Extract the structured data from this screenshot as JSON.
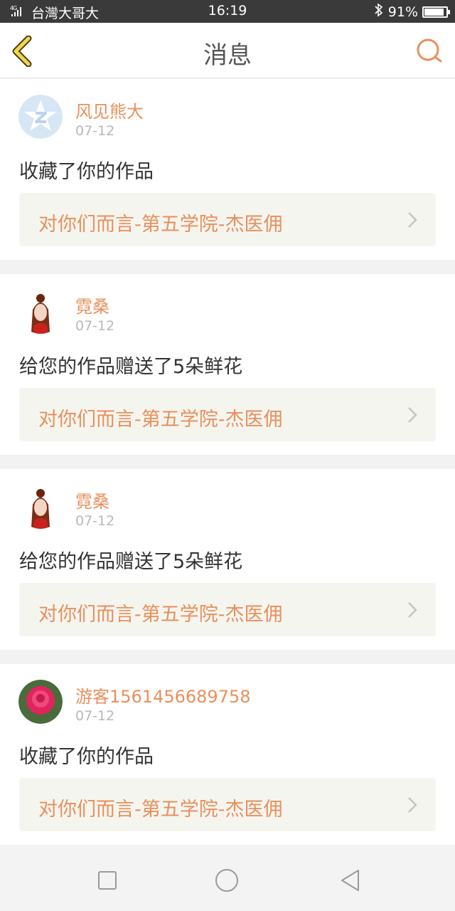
{
  "status_bar": {
    "carrier": "台灣大哥大",
    "network": "4G",
    "time": "16:19",
    "battery_percent": "91%",
    "battery_level": 0.91,
    "icons": [
      "signal-icon",
      "bluetooth-icon",
      "battery-icon"
    ]
  },
  "nav": {
    "title": "消息",
    "back_icon": "chevron-left-icon",
    "search_icon": "search-icon",
    "accent_color": "#e8905c",
    "back_color": "#f2c94c"
  },
  "messages": [
    {
      "username": "风见熊大",
      "date": "07-12",
      "action": "收藏了你的作品",
      "work_title": "对你们而言-第五学院-杰医佣",
      "avatar": "default-qq-avatar"
    },
    {
      "username": "霓桑",
      "date": "07-12",
      "action": "给您的作品赠送了5朵鲜花",
      "work_title": "对你们而言-第五学院-杰医佣",
      "avatar": "character-avatar"
    },
    {
      "username": "霓桑",
      "date": "07-12",
      "action": "给您的作品赠送了5朵鲜花",
      "work_title": "对你们而言-第五学院-杰医佣",
      "avatar": "character-avatar"
    },
    {
      "username": "游客1561456689758",
      "date": "07-12",
      "action": "收藏了你的作品",
      "work_title": "对你们而言-第五学院-杰医佣",
      "avatar": "rose-avatar"
    }
  ],
  "bottom_nav": {
    "icons": [
      "square-recent-icon",
      "circle-home-icon",
      "triangle-back-icon"
    ]
  }
}
